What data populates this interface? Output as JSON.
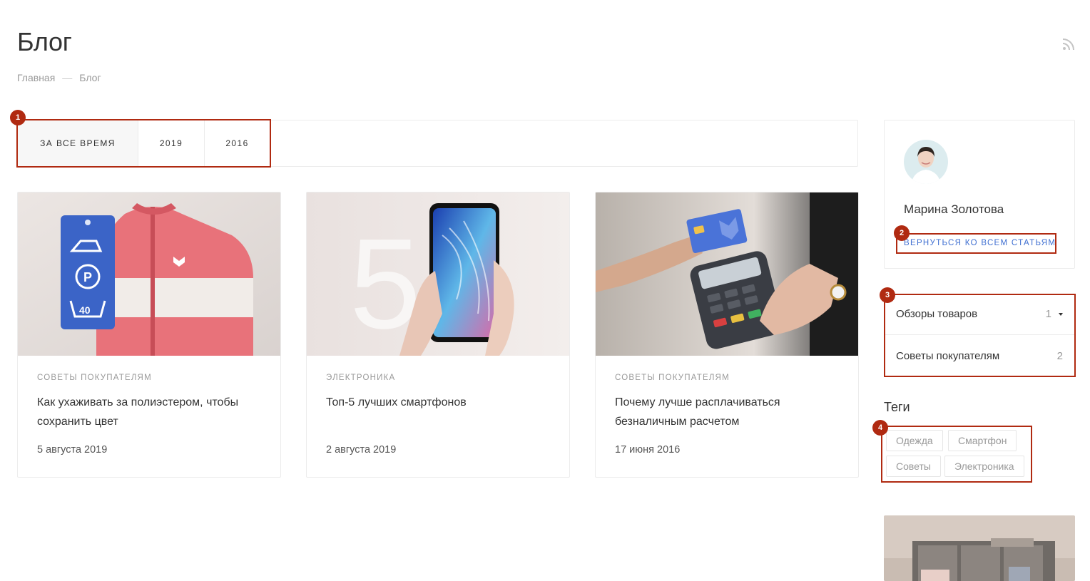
{
  "header": {
    "title": "Блог"
  },
  "breadcrumb": {
    "home": "Главная",
    "separator": "—",
    "current": "Блог"
  },
  "filters": {
    "years": [
      {
        "label": "ЗА ВСЕ ВРЕМЯ",
        "active": true
      },
      {
        "label": "2019",
        "active": false
      },
      {
        "label": "2016",
        "active": false
      }
    ]
  },
  "articles": [
    {
      "category": "СОВЕТЫ ПОКУПАТЕЛЯМ",
      "title": "Как ухаживать за полиэстером, чтобы сохранить цвет",
      "date": "5 августа 2019",
      "image": "pink-jacket-care-label"
    },
    {
      "category": "ЭЛЕКТРОНИКА",
      "title": "Топ-5 лучших смартфонов",
      "date": "2 августа 2019",
      "image": "hand-holding-smartphone"
    },
    {
      "category": "СОВЕТЫ ПОКУПАТЕЛЯМ",
      "title": "Почему лучше расплачиваться безналичным расчетом",
      "date": "17 июня 2016",
      "image": "card-payment-terminal"
    }
  ],
  "author": {
    "name": "Марина Золотова",
    "back_link": "ВЕРНУТЬСЯ КО ВСЕМ СТАТЬЯМ"
  },
  "categories": [
    {
      "name": "Обзоры товаров",
      "count": "1"
    },
    {
      "name": "Советы покупателям",
      "count": "2"
    }
  ],
  "tags": {
    "title": "Теги",
    "items": [
      "Одежда",
      "Смартфон",
      "Советы",
      "Электроника"
    ]
  },
  "annotations": [
    "1",
    "2",
    "3",
    "4"
  ],
  "colors": {
    "accent": "#3f6fd1",
    "highlight": "#b02a11",
    "border": "#ececec"
  }
}
